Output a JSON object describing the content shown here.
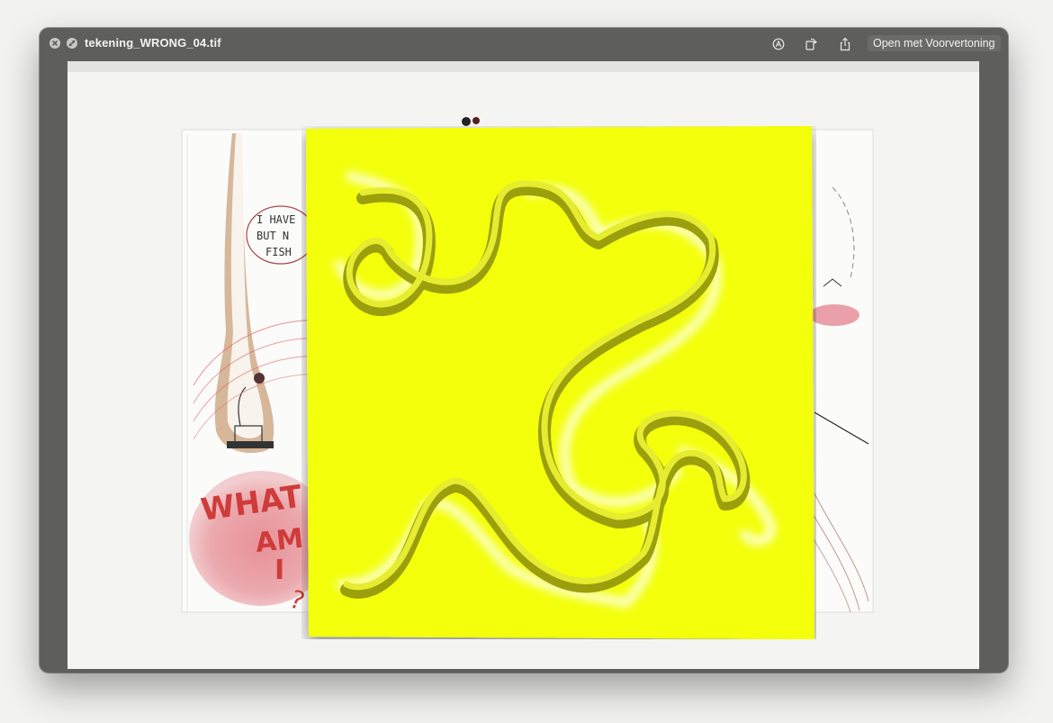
{
  "window": {
    "title": "tekening_WRONG_04.tif",
    "open_button_label": "Open met Voorvertoning"
  },
  "icons": {
    "close": "close-icon",
    "fullscreen": "fullscreen-icon",
    "markup": "markup-icon",
    "rotate": "rotate-icon",
    "share": "share-icon"
  },
  "drawing": {
    "speech_bubble_lines": [
      "I HAVE",
      "BUT N",
      "FISH"
    ],
    "caption_lines": [
      "WHAT",
      "AM",
      "I",
      "?"
    ]
  },
  "colors": {
    "window_chrome": "#5e5f5d",
    "overlay_yellow": "#f3ff0b",
    "drawing_red": "#cf3b3b"
  }
}
